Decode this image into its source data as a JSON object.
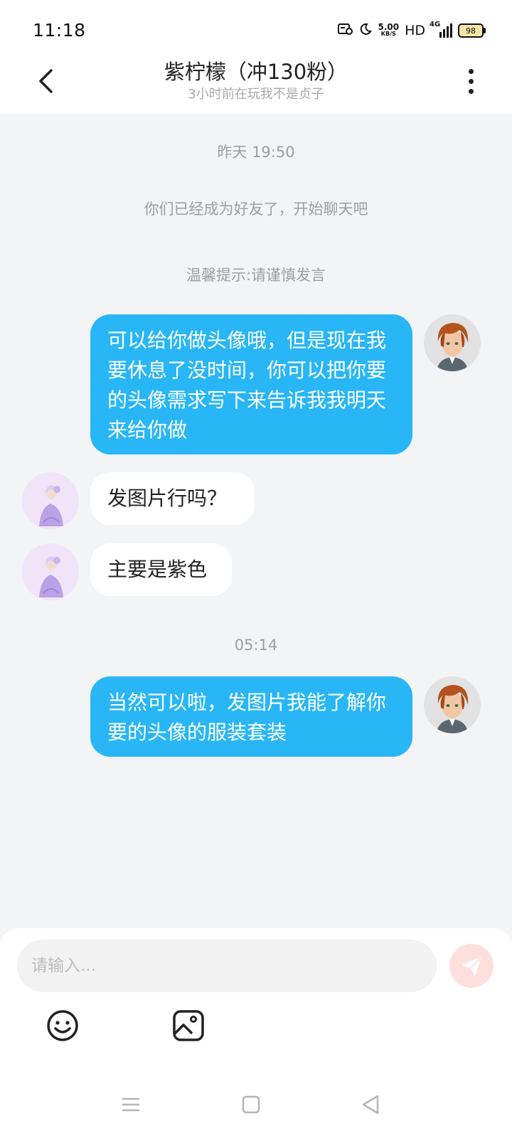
{
  "status": {
    "time": "11:18",
    "speed_value": "5.00",
    "speed_unit": "KB/S",
    "hd": "HD",
    "network": "4G",
    "battery": "98"
  },
  "header": {
    "title": "紫柠檬（冲130粉）",
    "subtitle": "3小时前在玩我不是贞子"
  },
  "messages": [
    {
      "type": "system",
      "text": "昨天 19:50"
    },
    {
      "type": "system",
      "text": "你们已经成为好友了，开始聊天吧"
    },
    {
      "type": "system",
      "text": "温馨提示:请谨慎发言"
    },
    {
      "type": "sent",
      "text": "可以给你做头像哦，但是现在我要休息了没时间，你可以把你要的头像需求写下来告诉我我明天来给你做"
    },
    {
      "type": "received",
      "text": "发图片行吗？"
    },
    {
      "type": "received",
      "text": "主要是紫色"
    },
    {
      "type": "system",
      "text": "05:14"
    },
    {
      "type": "sent",
      "text": "当然可以啦，发图片我能了解你要的头像的服装套装"
    }
  ],
  "composer": {
    "placeholder": "请输入...",
    "send_icon": "send-icon",
    "tools": [
      "emoji-icon",
      "image-icon"
    ]
  },
  "colors": {
    "sent_bubble": "#29b6f6",
    "received_bubble": "#ffffff",
    "background": "#f3f4f6",
    "send_button": "#fde0de"
  }
}
